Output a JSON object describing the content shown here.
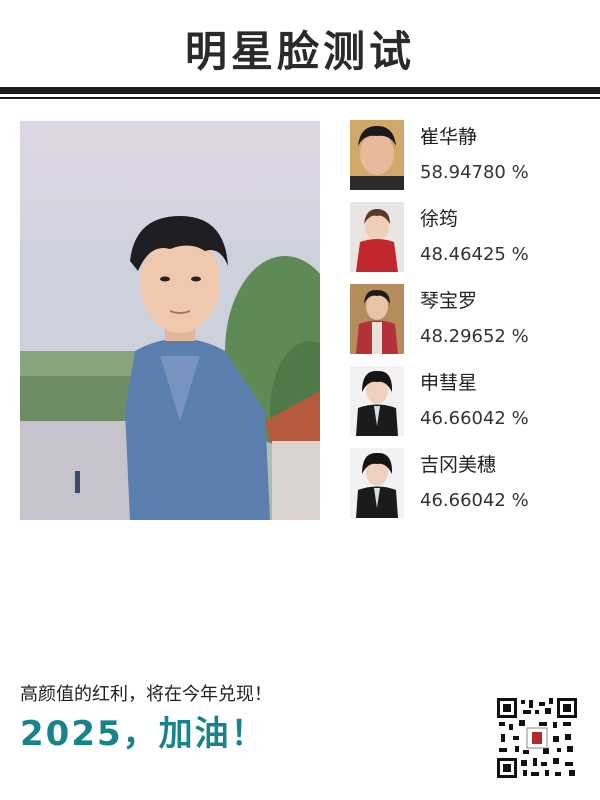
{
  "header": {
    "title": "明星脸测试"
  },
  "photo": {
    "icon": "user-portrait-photo"
  },
  "matches": [
    {
      "name": "崔华静",
      "score": "58.94780 %",
      "icon": "celebrity-portrait"
    },
    {
      "name": "徐筠",
      "score": "48.46425 %",
      "icon": "celebrity-portrait"
    },
    {
      "name": "琴宝罗",
      "score": "48.29652 %",
      "icon": "celebrity-portrait"
    },
    {
      "name": "申彗星",
      "score": "46.66042 %",
      "icon": "celebrity-portrait"
    },
    {
      "name": "吉冈美穗",
      "score": "46.66042 %",
      "icon": "celebrity-portrait"
    }
  ],
  "footer": {
    "line": "高颜值的红利，将在今年兑现！",
    "slogan": "2025，加油！"
  },
  "colors": {
    "accent": "#17838a",
    "rule": "#1a1a1a"
  }
}
